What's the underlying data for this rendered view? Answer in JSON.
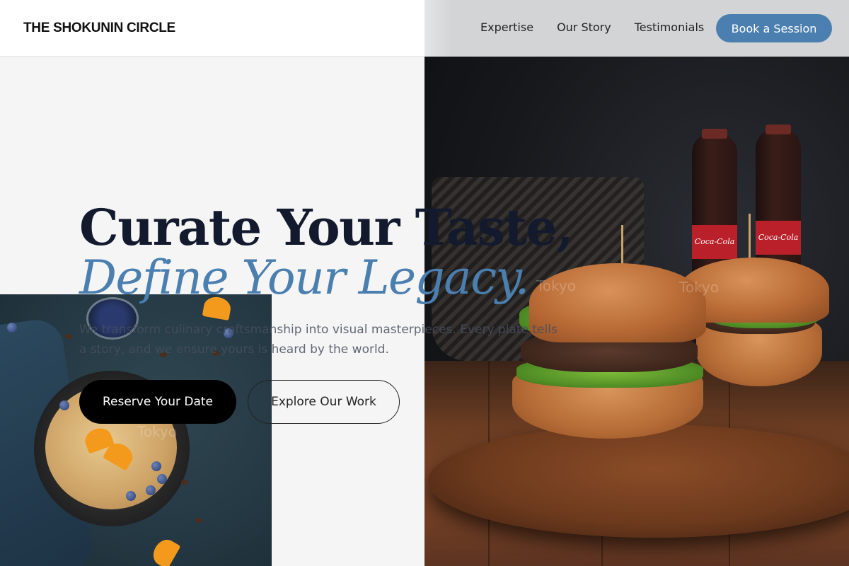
{
  "header": {
    "brand": "THE SHOKUNIN CIRCLE",
    "nav": [
      "Expertise",
      "Our Story",
      "Testimonials"
    ],
    "cta": "Book a Session"
  },
  "hero": {
    "title_line1": "Curate Your Taste,",
    "title_line2": "Define Your Legacy.",
    "subtitle": "We transform culinary craftsmanship into visual masterpieces. Every plate tells a story, and we ensure yours is heard by the world.",
    "primary_button": "Reserve Your Date",
    "secondary_button": "Explore Our Work"
  },
  "watermarks": [
    "Tokyo",
    "Tokyo",
    "Tokyo"
  ],
  "images": {
    "right": "burgers-on-wooden-board-photo",
    "left": "pancake-skillet-with-blueberries-photo"
  },
  "colors": {
    "accent": "#4a7fb0",
    "heading": "#131a2e",
    "background": "#f5f5f5",
    "primary_button": "#000000"
  }
}
